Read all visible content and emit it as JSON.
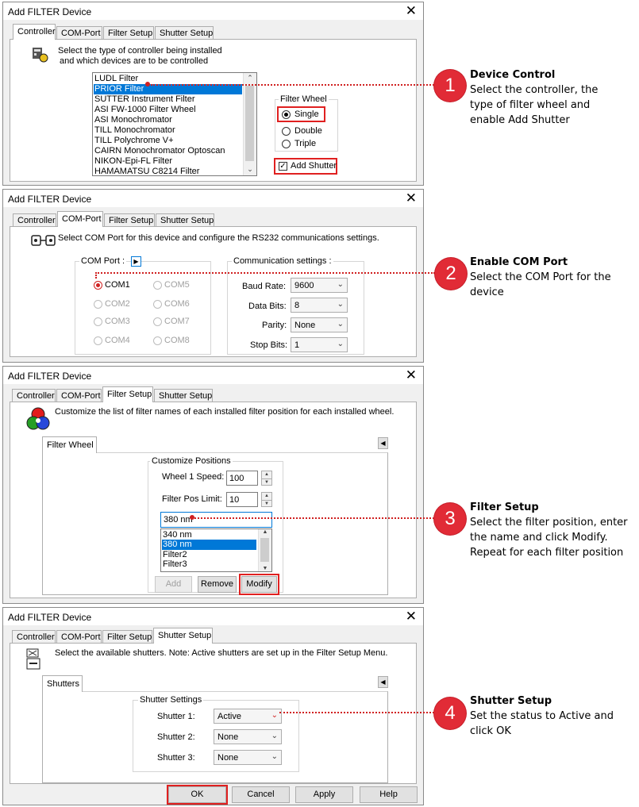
{
  "dialog_title": "Add FILTER Device",
  "tabs": [
    "Controller",
    "COM-Port",
    "Filter Setup",
    "Shutter Setup"
  ],
  "close_glyph": "✕",
  "colors": {
    "highlight": "#e02020",
    "badge": "#e12b36",
    "selection": "#0078d7"
  },
  "controller": {
    "desc_line1": "Select the type of controller being installed",
    "desc_line2": "and which devices are to be controlled",
    "list": [
      "LUDL Filter",
      "PRIOR Filter",
      "SUTTER Instrument Filter",
      "ASI FW-1000 Filter Wheel",
      "ASI Monochromator",
      "TILL Monochromator",
      "TILL Polychrome V+",
      "CAIRN Monochromator Optoscan",
      "NIKON-Epi-FL Filter",
      "HAMAMATSU C8214 Filter"
    ],
    "selected": "PRIOR Filter",
    "filter_wheel_label": "Filter Wheel",
    "wheel_options": [
      "Single",
      "Double",
      "Triple"
    ],
    "wheel_selected": "Single",
    "add_shutter_label": "Add Shutter",
    "add_shutter_checked": true
  },
  "comport": {
    "desc": "Select COM Port for this device and configure the RS232 communications settings.",
    "com_port_label": "COM Port :",
    "ports": [
      "COM1",
      "COM2",
      "COM3",
      "COM4",
      "COM5",
      "COM6",
      "COM7",
      "COM8"
    ],
    "selected_port": "COM1",
    "comm_label": "Communication settings :",
    "baud_rate_label": "Baud Rate:",
    "baud_rate": "9600",
    "data_bits_label": "Data Bits:",
    "data_bits": "8",
    "parity_label": "Parity:",
    "parity": "None",
    "stop_bits_label": "Stop Bits:",
    "stop_bits": "1"
  },
  "filter_setup": {
    "desc": "Customize the list of filter names of each installed filter position for each installed wheel.",
    "subtab": "Filter Wheel",
    "group_label": "Customize Positions",
    "wheel_speed_label": "Wheel 1 Speed:",
    "wheel_speed": "100",
    "pos_limit_label": "Filter Pos Limit:",
    "pos_limit": "10",
    "name_value": "380 nm",
    "list": [
      "340 nm",
      "380 nm",
      "Filter2",
      "Filter3"
    ],
    "selected": "380 nm",
    "add_label": "Add",
    "remove_label": "Remove",
    "modify_label": "Modify"
  },
  "shutter_setup": {
    "desc": "Select the available shutters. Note: Active shutters are set up in the Filter Setup Menu.",
    "subtab": "Shutters",
    "group_label": "Shutter Settings",
    "shutters": [
      {
        "label": "Shutter 1:",
        "value": "Active"
      },
      {
        "label": "Shutter 2:",
        "value": "None"
      },
      {
        "label": "Shutter 3:",
        "value": "None"
      }
    ]
  },
  "footer_buttons": {
    "ok": "OK",
    "cancel": "Cancel",
    "apply": "Apply",
    "help": "Help"
  },
  "annotations": [
    {
      "num": "1",
      "title": "Device Control",
      "desc": "Select the controller, the type of filter wheel and enable Add Shutter"
    },
    {
      "num": "2",
      "title": "Enable COM Port",
      "desc": "Select the COM Port for the device"
    },
    {
      "num": "3",
      "title": "Filter Setup",
      "desc": "Select the filter position, enter the name and click Modify. Repeat for each filter position"
    },
    {
      "num": "4",
      "title": "Shutter Setup",
      "desc": "Set the status to Active and click OK"
    }
  ]
}
